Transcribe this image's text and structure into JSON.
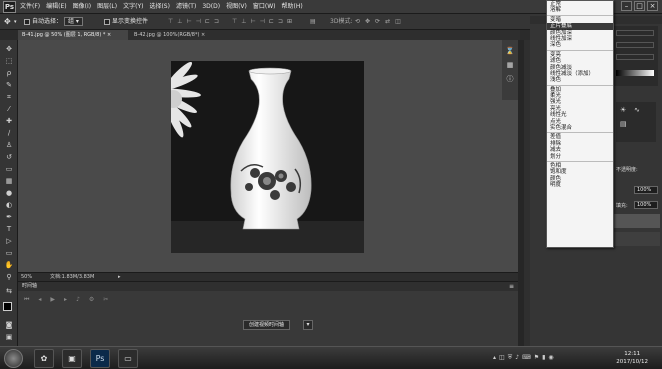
{
  "menubar": {
    "logo": "Ps",
    "items": [
      "文件(F)",
      "编辑(E)",
      "图像(I)",
      "图层(L)",
      "文字(Y)",
      "选择(S)",
      "滤镜(T)",
      "3D(D)",
      "视图(V)",
      "窗口(W)",
      "帮助(H)"
    ],
    "min": "–",
    "max": "□",
    "close": "×"
  },
  "options": {
    "auto_select_label": "自动选择：",
    "auto_select_value": "组",
    "show_transform_label": "显示变换控件"
  },
  "tabs": [
    {
      "label": "B-41.jpg @ 50% (图层 1, RGB/8) *",
      "close": "×"
    },
    {
      "label": "B-42.jpg @ 100%(RGB/8*)",
      "close": "×"
    }
  ],
  "status": {
    "zoom": "50%",
    "doc": "文档:1.83M/3.83M"
  },
  "timeline": {
    "title": "时间轴",
    "create_button": "创建视频时间轴",
    "dropdown_arrow": "▾"
  },
  "panels": {
    "opacity_label": "不透明度:",
    "opacity_value": "100%",
    "fill_label": "填充:",
    "fill_value": "100%"
  },
  "blend_modes": [
    [
      "正常",
      "溶解"
    ],
    [
      "变暗",
      "正片叠底",
      "颜色加深",
      "线性加深",
      "深色"
    ],
    [
      "变亮",
      "滤色",
      "颜色减淡",
      "线性减淡（添加）",
      "浅色"
    ],
    [
      "叠加",
      "柔光",
      "强光",
      "亮光",
      "线性光",
      "点光",
      "实色混合"
    ],
    [
      "差值",
      "排除",
      "减去",
      "划分"
    ],
    [
      "色相",
      "饱和度",
      "颜色",
      "明度"
    ]
  ],
  "blend_highlight": "正片叠底",
  "taskbar": {
    "time": "12:11",
    "date": "2017/10/12",
    "ps_label": "Ps"
  }
}
